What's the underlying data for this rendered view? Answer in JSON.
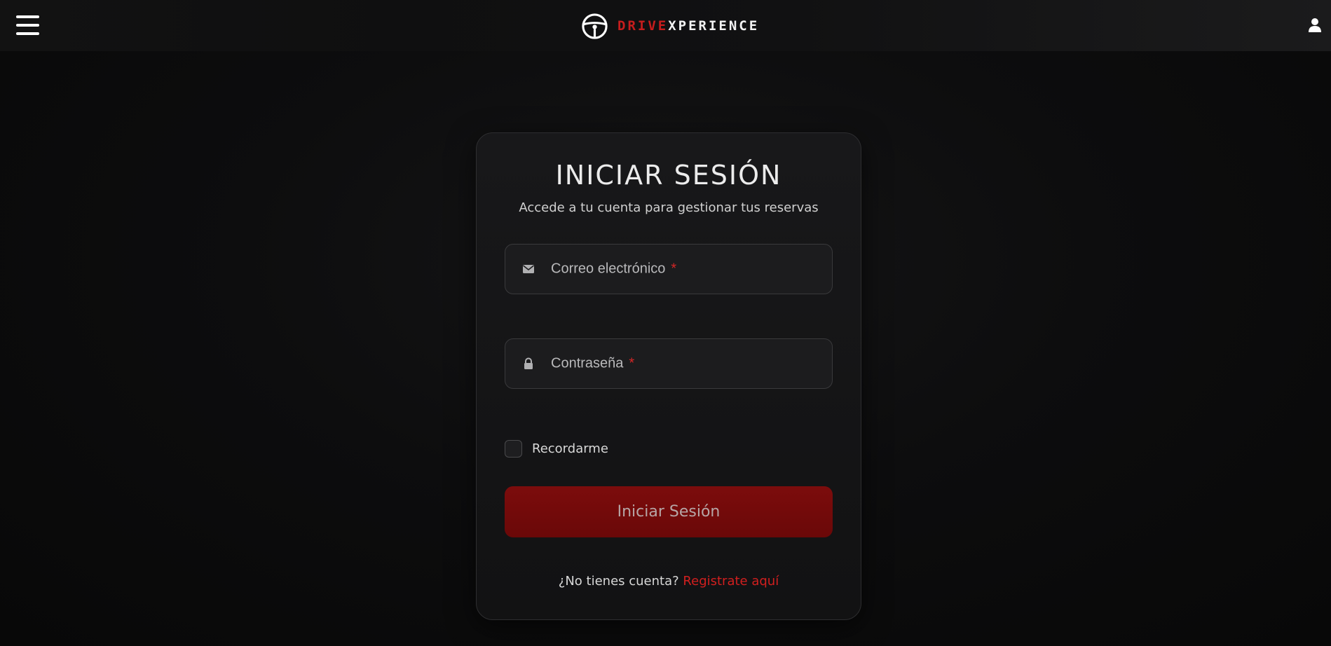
{
  "header": {
    "brand_drive": "DRIVE",
    "brand_xp": "XPERIENCE"
  },
  "login": {
    "title": "INICIAR SESIÓN",
    "subtitle": "Accede a tu cuenta para gestionar tus reservas",
    "email_label": "Correo electrónico",
    "password_label": "Contraseña",
    "required_mark": "*",
    "remember_label": "Recordarme",
    "submit_label": "Iniciar Sesión",
    "no_account_text": "¿No tienes cuenta?",
    "register_link": "Registrate aquí"
  },
  "colors": {
    "accent": "#c61d1d",
    "button": "#7c0c0c",
    "background": "#0b0b0c"
  },
  "icons": {
    "menu": "hamburger-icon",
    "logo": "steering-wheel-icon",
    "user": "user-icon",
    "email": "envelope-icon",
    "password": "lock-icon"
  }
}
